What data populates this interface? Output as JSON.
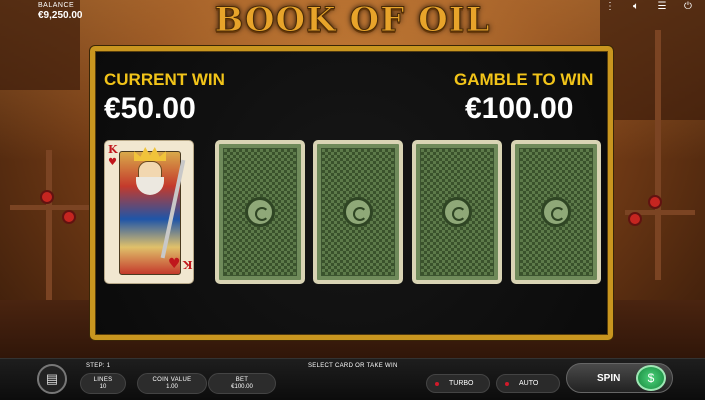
{
  "balance": {
    "label": "BALANCE",
    "value": "€9,250.00"
  },
  "top_icons": [
    "grid-icon",
    "speaker-icon",
    "menu-icon",
    "power-icon"
  ],
  "logo": {
    "text": "BOOK OF OIL"
  },
  "current_win": {
    "label": "CURRENT WIN",
    "value": "€50.00"
  },
  "gamble_to_win": {
    "label": "GAMBLE TO WIN",
    "value": "€100.00"
  },
  "revealed_card": {
    "rank": "K",
    "suit": "♥"
  },
  "hidden_cards_count": 4,
  "bottom": {
    "step": "STEP: 1",
    "message": "SELECT CARD OR TAKE WIN",
    "lines": {
      "label": "LINES",
      "value": "10"
    },
    "coin_value": {
      "label": "COIN VALUE",
      "value": "1.00"
    },
    "bet": {
      "label": "BET",
      "value": "€100.00"
    },
    "turbo_label": "TURBO",
    "auto_label": "AUTO",
    "spin_label": "SPIN"
  },
  "colors": {
    "accent_gold": "#f2c419",
    "frame_gold": "#c9961f",
    "spin_green": "#17873d",
    "toggle_red": "#d11a2a"
  }
}
